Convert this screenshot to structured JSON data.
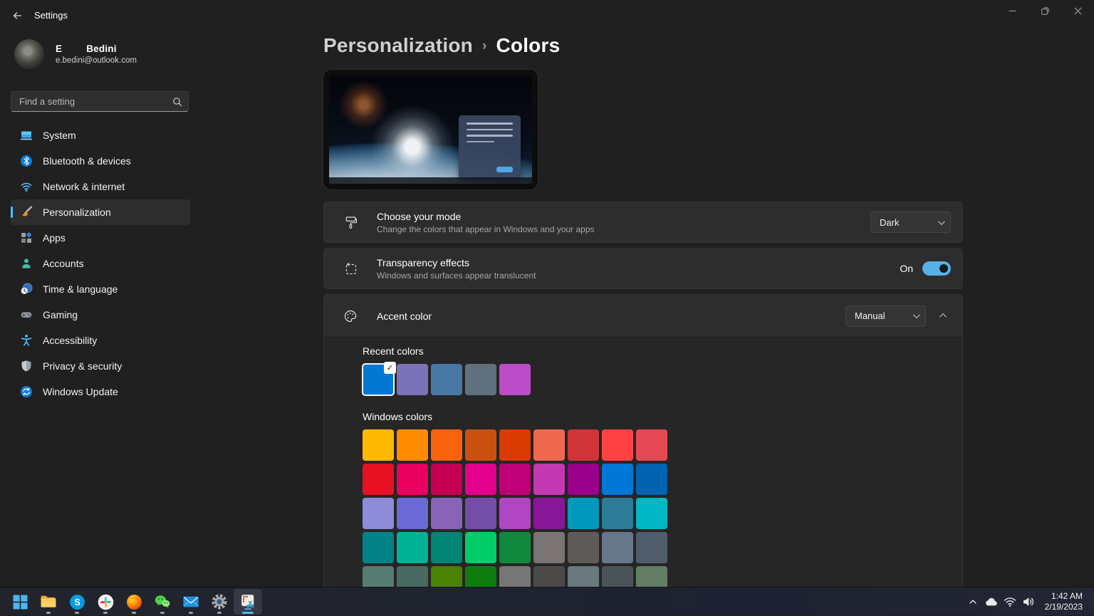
{
  "titlebar": {
    "title": "Settings",
    "controls": {
      "minimize": "minimize",
      "restore": "restore",
      "close": "close"
    }
  },
  "user": {
    "first_name": "E",
    "last_name": "Bedini",
    "email": "e.bedini@outlook.com"
  },
  "search": {
    "placeholder": "Find a setting"
  },
  "sidebar": {
    "items": [
      {
        "label": "System",
        "icon": "system-icon",
        "selected": false
      },
      {
        "label": "Bluetooth & devices",
        "icon": "bluetooth-icon",
        "selected": false
      },
      {
        "label": "Network & internet",
        "icon": "network-icon",
        "selected": false
      },
      {
        "label": "Personalization",
        "icon": "personalization-icon",
        "selected": true
      },
      {
        "label": "Apps",
        "icon": "apps-icon",
        "selected": false
      },
      {
        "label": "Accounts",
        "icon": "accounts-icon",
        "selected": false
      },
      {
        "label": "Time & language",
        "icon": "time-language-icon",
        "selected": false
      },
      {
        "label": "Gaming",
        "icon": "gaming-icon",
        "selected": false
      },
      {
        "label": "Accessibility",
        "icon": "accessibility-icon",
        "selected": false
      },
      {
        "label": "Privacy & security",
        "icon": "privacy-icon",
        "selected": false
      },
      {
        "label": "Windows Update",
        "icon": "windows-update-icon",
        "selected": false
      }
    ]
  },
  "breadcrumb": {
    "parent": "Personalization",
    "separator": "›",
    "current": "Colors"
  },
  "cards": {
    "mode": {
      "title": "Choose your mode",
      "subtitle": "Change the colors that appear in Windows and your apps",
      "value": "Dark",
      "icon": "paint-roller-icon"
    },
    "transparency": {
      "title": "Transparency effects",
      "subtitle": "Windows and surfaces appear translucent",
      "state": "On",
      "icon": "transparency-icon"
    },
    "accent": {
      "title": "Accent color",
      "value": "Manual",
      "icon": "palette-icon"
    }
  },
  "recent_colors": {
    "label": "Recent colors",
    "swatches": [
      {
        "color": "#0078D4",
        "selected": true
      },
      {
        "color": "#7B72B8",
        "selected": false
      },
      {
        "color": "#4A78A4",
        "selected": false
      },
      {
        "color": "#60707C",
        "selected": false
      },
      {
        "color": "#BB4DC8",
        "selected": false
      }
    ]
  },
  "windows_colors": {
    "label": "Windows colors",
    "swatches": [
      "#FFB900",
      "#FF8C00",
      "#F7630C",
      "#CA5010",
      "#DA3B01",
      "#EF6950",
      "#D13438",
      "#FF4343",
      "#E74856",
      "#E81123",
      "#EA005E",
      "#C30052",
      "#E3008C",
      "#BF0077",
      "#C239B3",
      "#9A0089",
      "#0078D7",
      "#0063B1",
      "#8E8CD8",
      "#6B69D6",
      "#8764B8",
      "#744DA9",
      "#B146C2",
      "#881798",
      "#0099BC",
      "#2D7D9A",
      "#00B7C3",
      "#038387",
      "#00B294",
      "#018574",
      "#00CC6A",
      "#10893E",
      "#7A7574",
      "#5D5A58",
      "#68768A",
      "#515C6B",
      "#567C73",
      "#486860",
      "#498205",
      "#107C10",
      "#767676",
      "#4C4A48",
      "#69797E",
      "#4A5459",
      "#647C64"
    ]
  },
  "taskbar": {
    "apps": [
      {
        "name": "start",
        "state": "none"
      },
      {
        "name": "file-explorer",
        "state": "running"
      },
      {
        "name": "skype",
        "state": "running"
      },
      {
        "name": "slack",
        "state": "running"
      },
      {
        "name": "firefox",
        "state": "running"
      },
      {
        "name": "wechat",
        "state": "running"
      },
      {
        "name": "mail",
        "state": "running"
      },
      {
        "name": "settings",
        "state": "running"
      },
      {
        "name": "snipping-tool",
        "state": "active"
      }
    ],
    "tray_icons": [
      "chevron-up-icon",
      "cloud-icon",
      "wifi-icon",
      "volume-icon"
    ],
    "clock": {
      "time": "1:42 AM",
      "date": "2/19/2023"
    }
  },
  "colors": {
    "accent": "#0078D4",
    "toggle_on": "#55B1E6",
    "selected_pill": "#4CC2FF"
  }
}
